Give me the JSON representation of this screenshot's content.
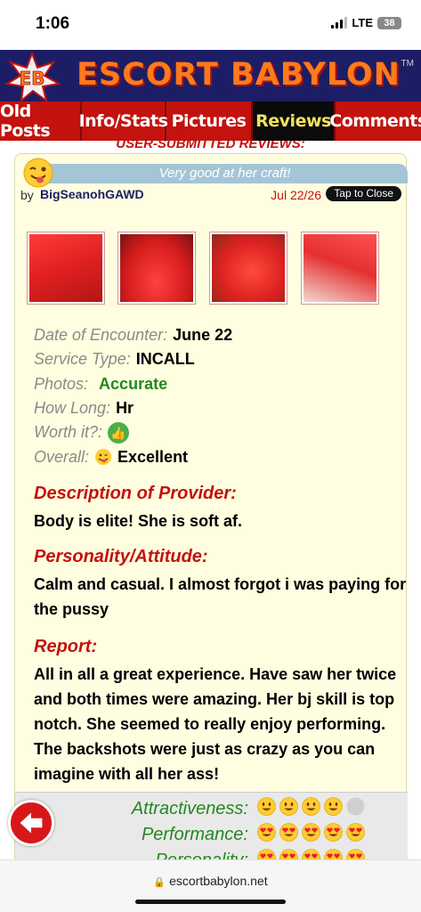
{
  "status_bar": {
    "time": "1:06",
    "network": "LTE",
    "battery": "38"
  },
  "site": {
    "badge": "EB",
    "title": "ESCORT BABYLON",
    "tm": "TM"
  },
  "nav": {
    "tabs": [
      "Old Posts",
      "Info/Stats",
      "Pictures",
      "Reviews",
      "Comments"
    ],
    "active": "Reviews"
  },
  "section_title": "USER-SUBMITTED REVIEWS:",
  "review": {
    "headline": "Very good at her craft!",
    "by_label": "by",
    "author": "BigSeanohGAWD",
    "date": "Jul 22/26",
    "close_label": "Tap to Close",
    "details": {
      "date_label": "Date of Encounter:",
      "date_value": "June 22",
      "service_label": "Service Type:",
      "service_value": "INCALL",
      "photos_label": "Photos:",
      "photos_value": "Accurate",
      "howlong_label": "How Long:",
      "howlong_value": "Hr",
      "worth_label": "Worth it?:",
      "overall_label": "Overall:",
      "overall_value": "Excellent"
    },
    "description_title": "Description of Provider:",
    "description_text": "Body is elite! She is soft af.",
    "personality_title": "Personality/Attitude:",
    "personality_text": "Calm and casual. I almost forgot i was paying for the pussy",
    "report_title": "Report:",
    "report_text": "All in all a great experience. Have saw her twice and both times were amazing. Her bj skill is top notch. She seemed to really enjoy performing. The backshots were just as crazy as you can imagine with all her ass!",
    "ratings": [
      {
        "label": "Attractiveness:",
        "score": 4,
        "max": 5,
        "icon": "smiley-face-icon"
      },
      {
        "label": "Performance:",
        "score": 5,
        "max": 5,
        "icon": "heart-eyes-icon"
      },
      {
        "label": "Personality:",
        "score": 5,
        "max": 5,
        "icon": "heart-eyes-icon"
      }
    ]
  },
  "browser": {
    "url": "escortbabylon.net"
  }
}
